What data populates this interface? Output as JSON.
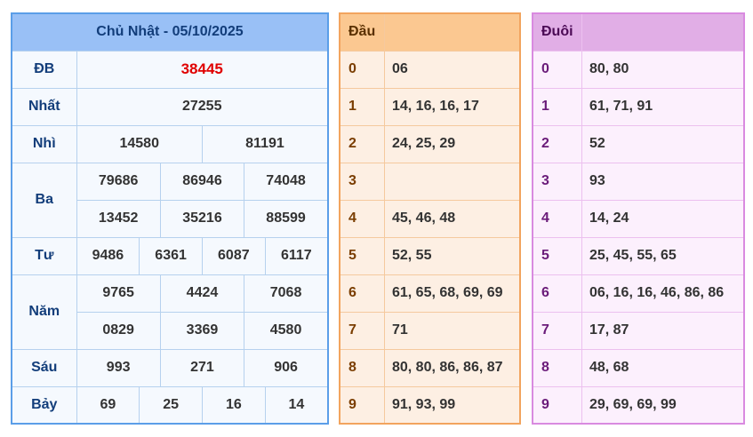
{
  "results": {
    "title": "Chủ Nhật - 05/10/2025",
    "db": {
      "label": "ĐB",
      "values": [
        "38445"
      ]
    },
    "nhat": {
      "label": "Nhất",
      "values": [
        "27255"
      ]
    },
    "nhi": {
      "label": "Nhì",
      "values": [
        "14580",
        "81191"
      ]
    },
    "ba": {
      "label": "Ba",
      "values": [
        "79686",
        "86946",
        "74048",
        "13452",
        "35216",
        "88599"
      ]
    },
    "tu": {
      "label": "Tư",
      "values": [
        "9486",
        "6361",
        "6087",
        "6117"
      ]
    },
    "nam": {
      "label": "Năm",
      "values": [
        "9765",
        "4424",
        "7068",
        "0829",
        "3369",
        "4580"
      ]
    },
    "sau": {
      "label": "Sáu",
      "values": [
        "993",
        "271",
        "906"
      ]
    },
    "bay": {
      "label": "Bảy",
      "values": [
        "69",
        "25",
        "16",
        "14"
      ]
    }
  },
  "dau": {
    "header": "Đầu",
    "rows": [
      {
        "digit": "0",
        "values": "06"
      },
      {
        "digit": "1",
        "values": "14, 16, 16, 17"
      },
      {
        "digit": "2",
        "values": "24, 25, 29"
      },
      {
        "digit": "3",
        "values": ""
      },
      {
        "digit": "4",
        "values": "45, 46, 48"
      },
      {
        "digit": "5",
        "values": "52, 55"
      },
      {
        "digit": "6",
        "values": "61, 65, 68, 69, 69"
      },
      {
        "digit": "7",
        "values": "71"
      },
      {
        "digit": "8",
        "values": "80, 80, 86, 86, 87"
      },
      {
        "digit": "9",
        "values": "91, 93, 99"
      }
    ]
  },
  "duoi": {
    "header": "Đuôi",
    "rows": [
      {
        "digit": "0",
        "values": "80, 80"
      },
      {
        "digit": "1",
        "values": "61, 71, 91"
      },
      {
        "digit": "2",
        "values": "52"
      },
      {
        "digit": "3",
        "values": "93"
      },
      {
        "digit": "4",
        "values": "14, 24"
      },
      {
        "digit": "5",
        "values": "25, 45, 55, 65"
      },
      {
        "digit": "6",
        "values": "06, 16, 16, 46, 86, 86"
      },
      {
        "digit": "7",
        "values": "17, 87"
      },
      {
        "digit": "8",
        "values": "48, 68"
      },
      {
        "digit": "9",
        "values": "29, 69, 69, 99"
      }
    ]
  },
  "colors": {
    "main_border": "#5b9ee8",
    "main_header_bg": "#99c0f6",
    "db_value": "#e00000",
    "dau_border": "#f2a45e",
    "dau_header_bg": "#fbc891",
    "duoi_border": "#d98ae0",
    "duoi_header_bg": "#e1aee6"
  }
}
